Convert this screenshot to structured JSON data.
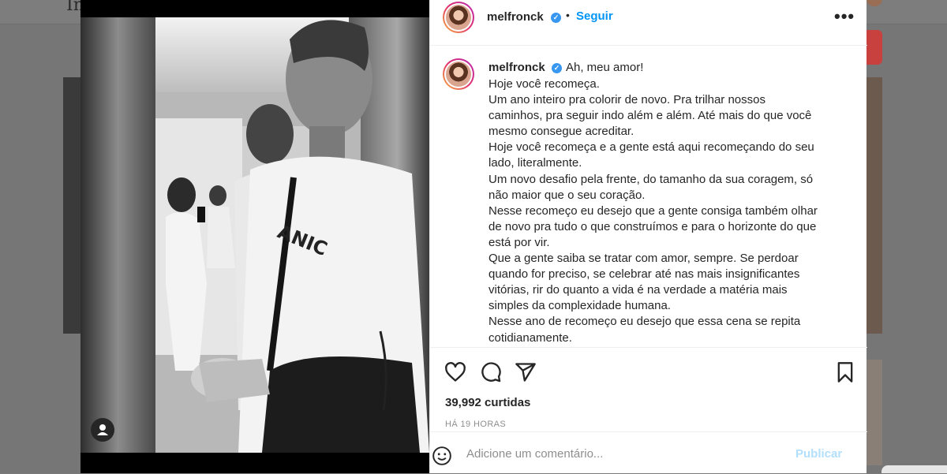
{
  "background_page": {
    "logo_fragment": "In"
  },
  "post": {
    "username": "melfronck",
    "follow_label": "Seguir",
    "more_label": "•••",
    "user_icon_label": "tagged-user-icon"
  },
  "caption": {
    "username": "melfronck",
    "first_line": "Ah, meu amor!",
    "lines": [
      "Hoje você recomeça.",
      "Um ano inteiro pra colorir de novo. Pra trilhar nossos",
      "caminhos, pra seguir indo além e além. Até mais do que você",
      "mesmo consegue acreditar.",
      "Hoje você recomeça e a gente está aqui recomeçando do seu",
      "lado, literalmente.",
      "Um novo desafio pela frente, do tamanho da sua coragem, só",
      "não maior que o seu coração.",
      "Nesse recomeço eu desejo que a gente consiga também olhar",
      "de novo pra tudo o que construímos e para o horizonte do que",
      "está por vir.",
      "Que a gente saiba se tratar com amor, sempre. Se perdoar",
      "quando for preciso, se celebrar até nas mais insignificantes",
      "vitórias, rir do quanto a vida é na verdade a matéria mais",
      "simples da complexidade humana.",
      "Nesse ano de recomeço eu desejo que essa cena se repita",
      "cotidianamente."
    ]
  },
  "stats": {
    "likes": "39,992 curtidas",
    "time": "HÁ 19 HORAS"
  },
  "comment": {
    "placeholder": "Adicione um comentário...",
    "publish_label": "Publicar"
  },
  "colors": {
    "accent": "#0095f6",
    "publish_disabled": "#b2dffc",
    "verified": "#3897f0",
    "text": "#262626",
    "muted": "#8e8e8e"
  },
  "icons": [
    "heart-icon",
    "comment-icon",
    "share-icon",
    "bookmark-icon",
    "emoji-icon",
    "verified-icon",
    "tagged-user-icon"
  ]
}
